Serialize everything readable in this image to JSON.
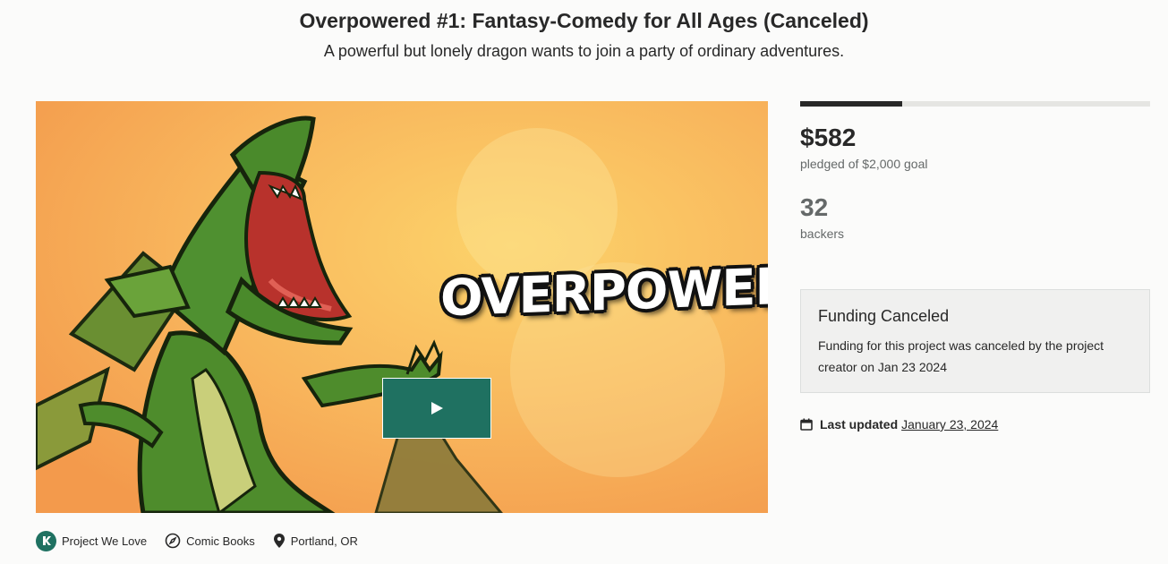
{
  "header": {
    "title": "Overpowered #1: Fantasy-Comedy for All Ages (Canceled)",
    "subtitle": "A powerful but lonely dragon wants to join a party of ordinary adventures."
  },
  "media": {
    "logo_text": "OVERPOWERED",
    "play_icon": "play-icon"
  },
  "tags": [
    {
      "label": "Project We Love",
      "icon": "kickstarter-badge-icon"
    },
    {
      "label": "Comic Books",
      "icon": "compass-icon"
    },
    {
      "label": "Portland, OR",
      "icon": "location-pin-icon"
    }
  ],
  "funding": {
    "progress_fraction": 0.291,
    "pledged": "$582",
    "pledged_label": "pledged of $2,000 goal",
    "backers": "32",
    "backers_label": "backers"
  },
  "status": {
    "heading": "Funding Canceled",
    "text": "Funding for this project was canceled by the project creator on Jan 23 2024"
  },
  "updated": {
    "label": "Last updated",
    "date": "January 23, 2024",
    "icon": "calendar-icon"
  },
  "colors": {
    "accent": "#1f7161",
    "text": "#282828",
    "muted": "#656969",
    "background": "#fbfbfa"
  }
}
